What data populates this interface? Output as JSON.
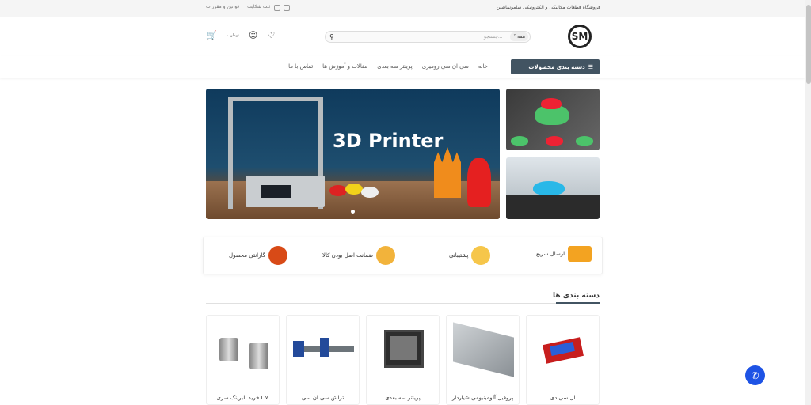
{
  "topbar": {
    "store_name": "فروشگاه قطعات مکانیکی و الکترونیکی سامونماشین",
    "complaint_link": "ثبت شکایت",
    "rules_link": "قوانین و مقررات"
  },
  "header": {
    "logo_text": "SM",
    "search_placeholder": "جستجو...",
    "search_category": "همه",
    "cart_label": "۰ تومان"
  },
  "nav": {
    "categories_button": "دسته بندی محصولات",
    "links": [
      "خانه",
      "سی ان سی رومیزی",
      "پرینتر سه بعدی",
      "مقالات و آموزش ها",
      "تماس با ما"
    ]
  },
  "banner": {
    "title": "3D Printer"
  },
  "features": [
    {
      "label": "ارسال سریع",
      "icon": "truck-icon"
    },
    {
      "label": "پشتیبانی",
      "icon": "support-icon"
    },
    {
      "label": "ضمانت اصل بودن کالا",
      "icon": "medal-icon"
    },
    {
      "label": "گارانتی محصول",
      "icon": "guarantee-badge-icon"
    }
  ],
  "categories_section": {
    "title": "دسته بندی ها",
    "items": [
      {
        "name": "ال سی دی"
      },
      {
        "name": "پروفیل آلومینیومی شیاردار"
      },
      {
        "name": "پرینتر سه بعدی"
      },
      {
        "name": "تراش سی ان سی"
      },
      {
        "name": "خرید بلبرینگ سری LM"
      }
    ]
  },
  "colors": {
    "nav_button": "#425462",
    "fab": "#1e53e5"
  }
}
